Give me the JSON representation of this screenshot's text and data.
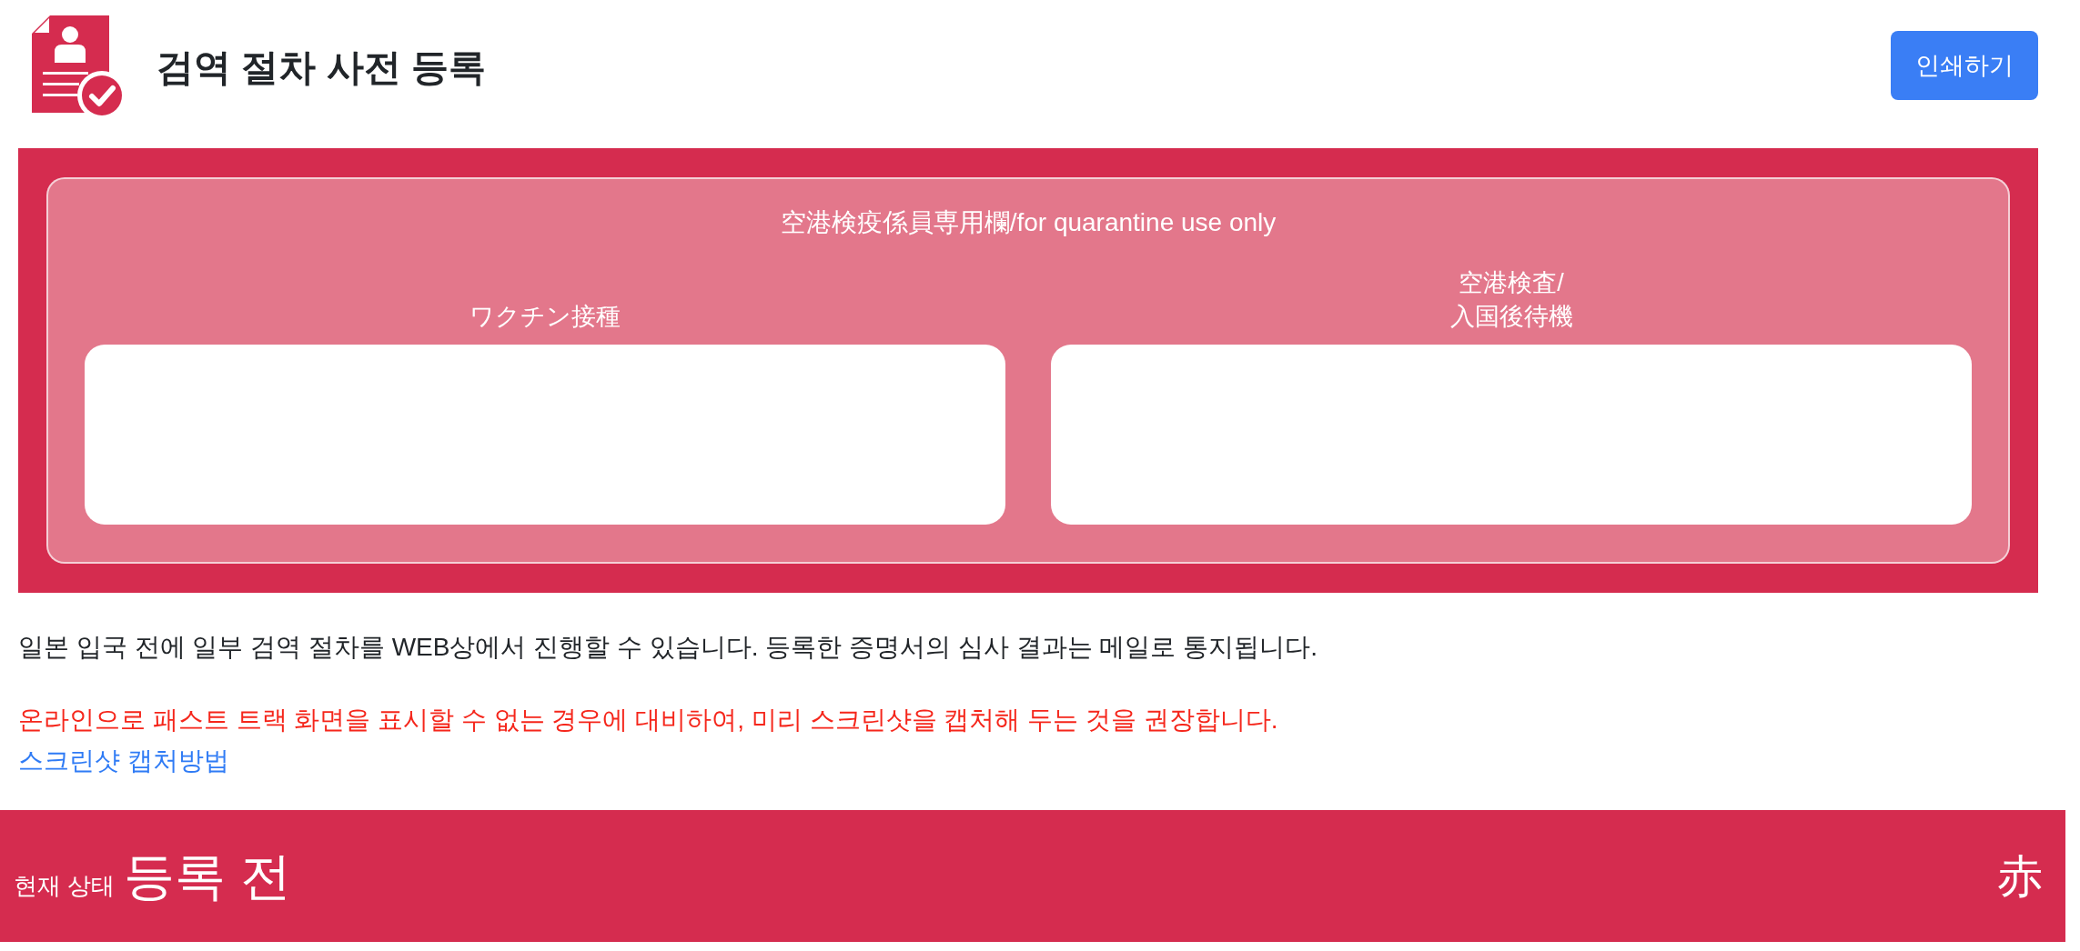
{
  "header": {
    "title": "검역 절차 사전 등록",
    "print_button": "인쇄하기"
  },
  "quarantine_panel": {
    "heading": "空港検疫係員専用欄/for quarantine use only",
    "columns": [
      {
        "label": "ワクチン接種"
      },
      {
        "label": "空港検査/\n入国後待機"
      }
    ]
  },
  "notice": "일본 입국 전에 일부 검역 절차를 WEB상에서 진행할 수 있습니다. 등록한 증명서의 심사 결과는 메일로 통지됩니다.",
  "warning": "온라인으로 패스트 트랙 화면을 표시할 수 없는 경우에 대비하여, 미리 스크린샷을 캡처해 두는 것을 권장합니다.",
  "capture_link": "스크린샷 캡처방법",
  "status_bar": {
    "label": "현재 상태",
    "status": "등록 전",
    "color_code": "赤"
  }
}
